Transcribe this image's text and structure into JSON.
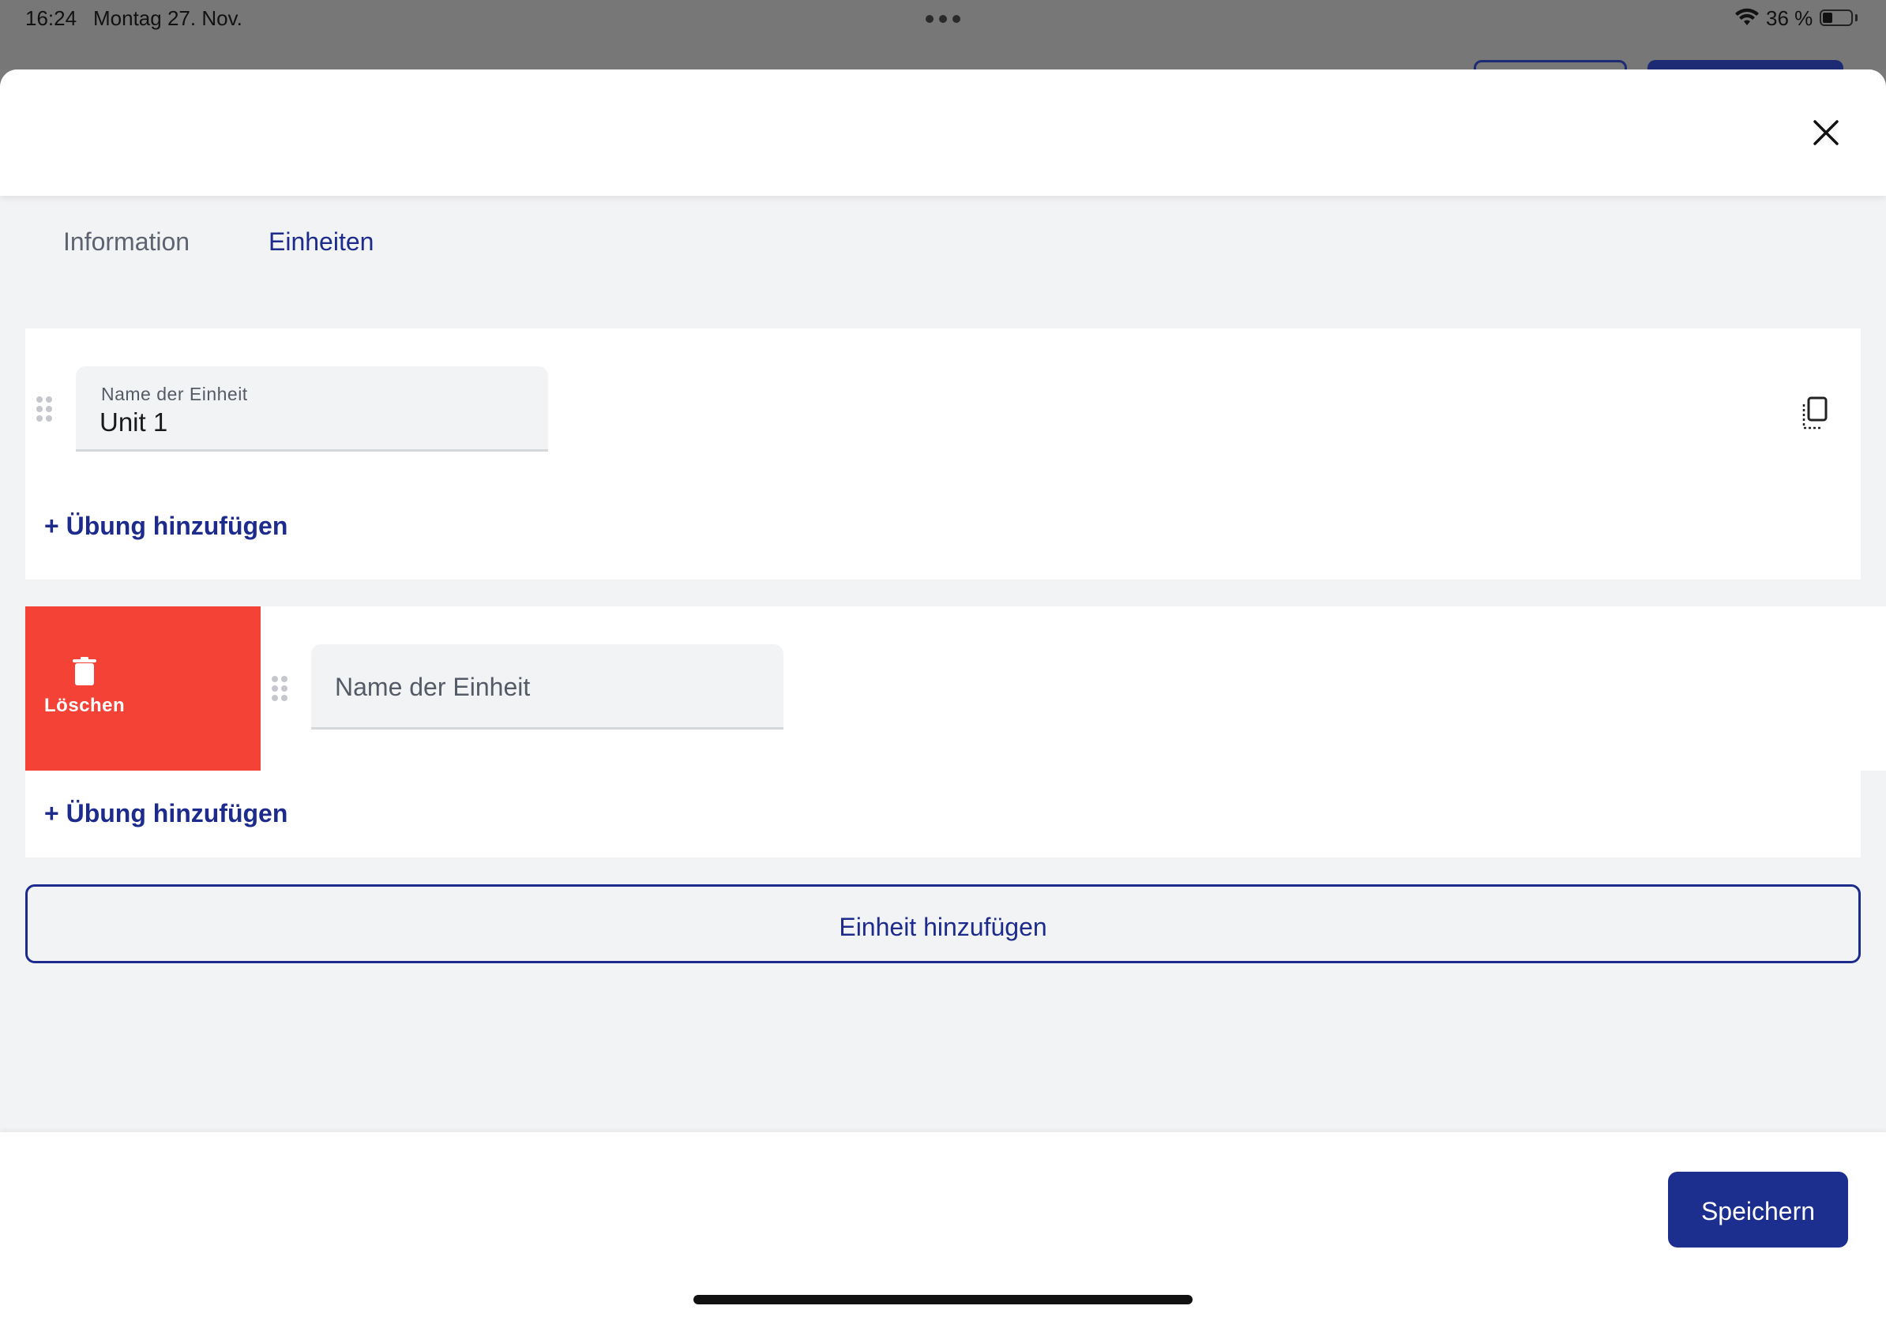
{
  "status_bar": {
    "time": "16:24",
    "date": "Montag 27. Nov.",
    "battery_text": "36 %",
    "battery_level": 0.36
  },
  "tabs": [
    {
      "label": "Information",
      "active": false
    },
    {
      "label": "Einheiten",
      "active": true
    }
  ],
  "units": [
    {
      "field_label": "Name der Einheit",
      "name_value": "Unit 1",
      "add_exercise_label": "+ Übung hinzufügen"
    },
    {
      "field_placeholder": "Name der Einheit",
      "name_value": "",
      "delete_label": "Löschen",
      "add_exercise_label": "+ Übung hinzufügen"
    }
  ],
  "add_unit_label": "Einheit hinzufügen",
  "save_label": "Speichern",
  "colors": {
    "primary": "#1c2b8c",
    "danger": "#f44336",
    "background": "#f2f3f5"
  },
  "icons": [
    "close-icon",
    "drag-handle-icon",
    "copy-icon",
    "trash-icon",
    "wifi-icon",
    "battery-icon"
  ]
}
